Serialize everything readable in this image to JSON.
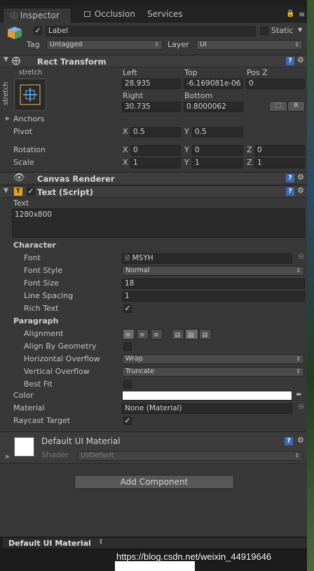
{
  "tabs": [
    {
      "label": "Inspector",
      "icon": "info-icon"
    },
    {
      "label": "Occlusion",
      "icon": "occlusion-icon"
    },
    {
      "label": "Services"
    }
  ],
  "gameobject": {
    "active": true,
    "name": "Label",
    "static_label": "Static",
    "tag_label": "Tag",
    "tag_value": "Untagged",
    "layer_label": "Layer",
    "layer_value": "UI"
  },
  "rect_transform": {
    "title": "Rect Transform",
    "anchor_top_label": "stretch",
    "anchor_side_label": "stretch",
    "left_label": "Left",
    "left": "28.935",
    "top_label": "Top",
    "top": "-6.169081e-06",
    "posz_label": "Pos Z",
    "posz": "0",
    "right_label": "Right",
    "right": "30.735",
    "bottom_label": "Bottom",
    "bottom": "0.8000062",
    "r_button": "R",
    "anchors_label": "Anchors",
    "pivot_label": "Pivot",
    "pivot": {
      "x": "0.5",
      "y": "0.5"
    },
    "rotation_label": "Rotation",
    "rotation": {
      "x": "0",
      "y": "0",
      "z": "0"
    },
    "scale_label": "Scale",
    "scale": {
      "x": "1",
      "y": "1",
      "z": "1"
    },
    "axis": {
      "x": "X",
      "y": "Y",
      "z": "Z"
    }
  },
  "canvas_renderer": {
    "title": "Canvas Renderer"
  },
  "text_script": {
    "title": "Text (Script)",
    "enabled": true,
    "text_label": "Text",
    "text_value": "1280x800",
    "character_label": "Character",
    "font_label": "Font",
    "font_value": "MSYH",
    "font_style_label": "Font Style",
    "font_style_value": "Normal",
    "font_size_label": "Font Size",
    "font_size_value": "18",
    "line_spacing_label": "Line Spacing",
    "line_spacing_value": "1",
    "rich_text_label": "Rich Text",
    "rich_text": true,
    "paragraph_label": "Paragraph",
    "alignment_label": "Alignment",
    "align_geometry_label": "Align By Geometry",
    "align_geometry": false,
    "h_overflow_label": "Horizontal Overflow",
    "h_overflow_value": "Wrap",
    "v_overflow_label": "Vertical Overflow",
    "v_overflow_value": "Truncate",
    "best_fit_label": "Best Fit",
    "best_fit": false,
    "color_label": "Color",
    "color_value": "#ffffff",
    "material_label": "Material",
    "material_value": "None (Material)",
    "raycast_label": "Raycast Target",
    "raycast": true
  },
  "material_panel": {
    "title": "Default UI Material",
    "shader_label": "Shader",
    "shader_value": "UI/Default"
  },
  "add_component_label": "Add Component",
  "preview": {
    "title": "Default UI Material"
  },
  "watermark": "https://blog.csdn.net/weixin_44919646",
  "colors": {
    "background": "#383838",
    "header": "#3e3e3e",
    "field": "#2a2a2a",
    "accent": "#3d6bb3"
  }
}
